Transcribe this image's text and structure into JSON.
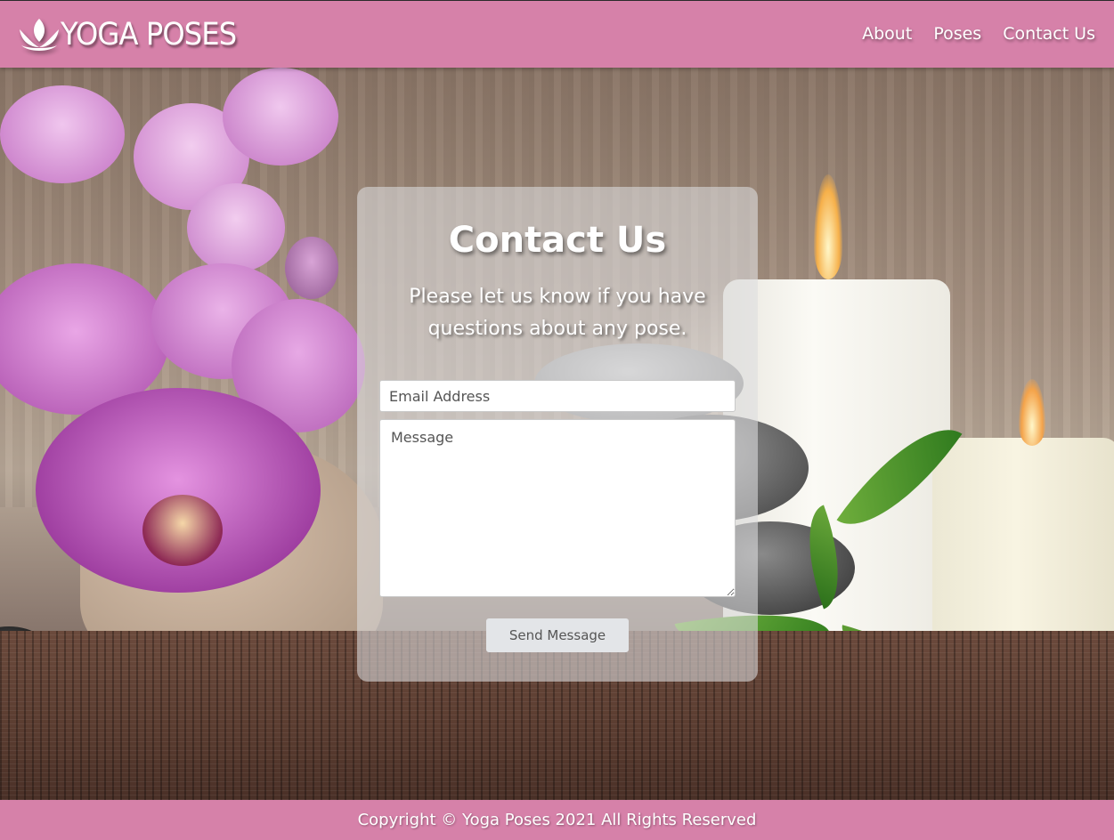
{
  "brand": {
    "name": "YOGA POSES",
    "icon": "lotus-icon"
  },
  "nav": {
    "items": [
      {
        "label": "About"
      },
      {
        "label": "Poses"
      },
      {
        "label": "Contact Us"
      }
    ]
  },
  "contact": {
    "title": "Contact Us",
    "subtitle": "Please let us know if you have questions about any pose.",
    "email_placeholder": "Email Address",
    "message_placeholder": "Message",
    "send_label": "Send Message"
  },
  "footer": {
    "text": "Copyright © Yoga Poses 2021 All Rights Reserved"
  },
  "colors": {
    "header_bg": "#d681a9",
    "footer_bg": "#d681a9",
    "card_bg": "rgba(220,220,222,0.58)",
    "button_bg": "#e3e5e8"
  }
}
